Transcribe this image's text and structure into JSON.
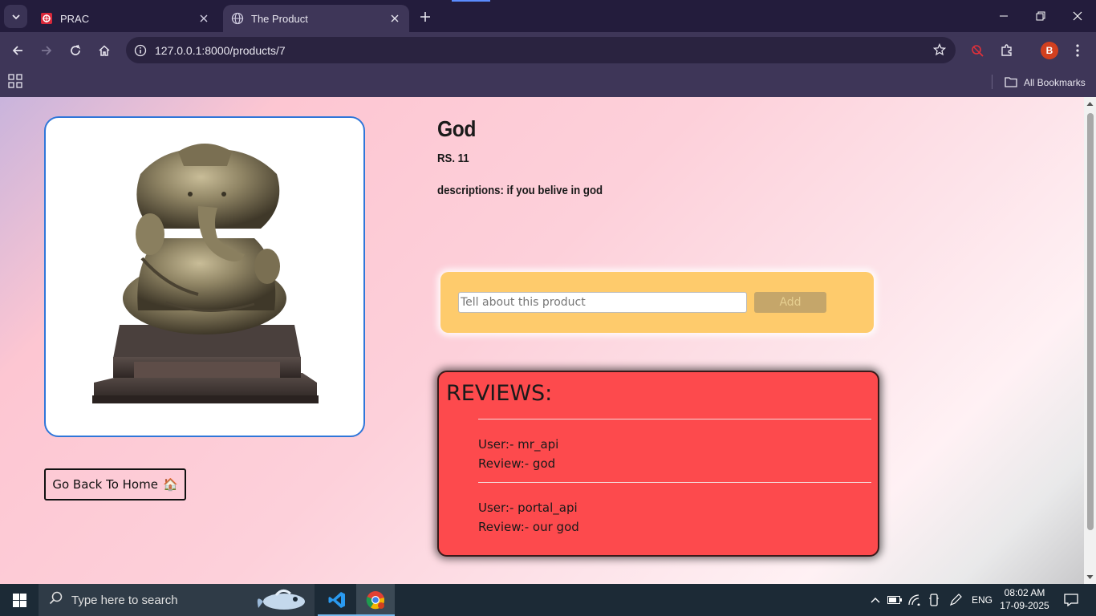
{
  "browser": {
    "tabs": [
      {
        "title": "PRAC",
        "favicon": "prac-favicon",
        "active": false
      },
      {
        "title": "The Product",
        "favicon": "globe-icon",
        "active": true
      }
    ],
    "url": "127.0.0.1:8000/products/7",
    "profile_initial": "B",
    "bookmarks_label": "All Bookmarks"
  },
  "product": {
    "name": "God",
    "price": "RS. 11",
    "description": "descriptions: if you belive in god",
    "image_subject": "brass Ganesha idol on dark wooden base"
  },
  "review_form": {
    "placeholder": "Tell about this product",
    "value": "",
    "add_label": "Add"
  },
  "reviews": {
    "title": "REVIEWS:",
    "items": [
      {
        "user": "User:- mr_api",
        "review": "Review:- god"
      },
      {
        "user": "User:- portal_api",
        "review": "Review:- our god"
      }
    ]
  },
  "back_button": {
    "label": "Go Back To Home",
    "emoji": "🏠"
  },
  "taskbar": {
    "search_placeholder": "Type here to search",
    "language": "ENG",
    "time": "08:02 AM",
    "date": "17-09-2025"
  },
  "colors": {
    "form_bg": "#fecb6c",
    "reviews_bg": "#fd4a4d",
    "image_border": "#2f76d9",
    "profile": "#d2401f"
  }
}
